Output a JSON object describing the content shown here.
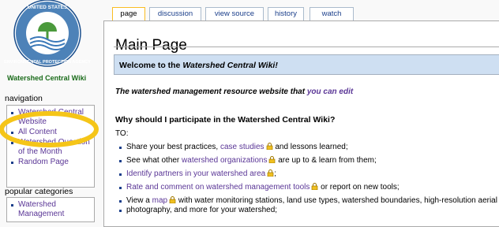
{
  "site": {
    "logo_label": "EPA seal: United States Environmental Protection Agency",
    "seal_text_top": "UNITED STATES",
    "seal_text_bottom": "ENVIRONMENTAL PROTECTION AGENCY",
    "caption": "Watershed Central Wiki"
  },
  "tabs": [
    {
      "label": "page",
      "selected": true
    },
    {
      "label": "discussion",
      "selected": false
    },
    {
      "label": "view source",
      "selected": false
    },
    {
      "label": "history",
      "selected": false
    },
    {
      "label": "watch",
      "selected": false
    }
  ],
  "navigation": {
    "title": "navigation",
    "items": [
      {
        "label": "Watershed Central Website"
      },
      {
        "label": "All Content"
      },
      {
        "label": "Watershed Question of the Month"
      },
      {
        "label": "Random Page"
      }
    ]
  },
  "popular": {
    "title": "popular categories",
    "items": [
      {
        "label": "Watershed Management"
      }
    ]
  },
  "main": {
    "title": "Main Page",
    "welcome_prefix": "Welcome to the ",
    "welcome_name": "Watershed Central Wiki!",
    "tagline_prefix": "The watershed management resource website that ",
    "tagline_link": "you can edit",
    "why_heading": "Why should I participate in the Watershed Central Wiki?",
    "to_label": "TO:",
    "bullets": [
      {
        "pre": "Share your best practices, ",
        "link": "case studies",
        "post": " and lessons learned;"
      },
      {
        "pre": "See what other ",
        "link": "watershed organizations",
        "post": " are up to & learn from them;"
      },
      {
        "pre": "",
        "link": "Identify partners in your watershed area",
        "post": ";"
      },
      {
        "pre": "",
        "link": "Rate and comment on watershed management tools",
        "post": " or report on new tools;"
      },
      {
        "pre": "View a ",
        "link": "map",
        "post": " with water monitoring stations, land use types, watershed boundaries, high-resolution aerial"
      },
      {
        "pre": "",
        "link": "",
        "post": "photography, and more for your watershed;"
      }
    ]
  },
  "colors": {
    "link": "#5a3696",
    "welcome_bg": "#cedff2",
    "highlight": "#f5c518",
    "caption_green": "#1a6b1a"
  }
}
